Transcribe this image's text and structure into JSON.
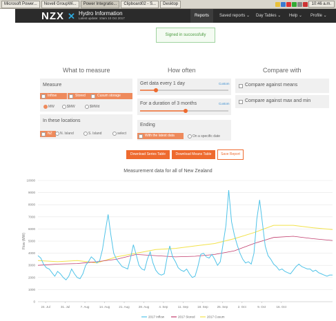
{
  "taskbar": {
    "tasks": [
      "Microsoft Power...",
      "Novell GroupWi...",
      "Power Integratio...",
      "Clipboard02 - S...",
      "Desktop"
    ],
    "clock": "10:46 a.m."
  },
  "header": {
    "logo": "NZX",
    "title": "Hydro Information",
    "subtitle": "Latest update: 10am 10 Oct 2017",
    "nav": [
      "Reports",
      "Saved reports",
      "Day Tables",
      "Help",
      "Profile"
    ]
  },
  "alert": "Signed in successfully",
  "measure": {
    "heading": "What to measure",
    "panel_label": "Measure",
    "checks": [
      "Inflow",
      "Stored",
      "Cusum storage"
    ],
    "units": [
      "MW",
      "$MW",
      "$MWd"
    ],
    "locations_label": "In these locations",
    "locations": [
      "NZ",
      "N. Island",
      "S. Island",
      "select"
    ]
  },
  "often": {
    "heading": "How often",
    "every": "Get data every 1 day",
    "duration": "For a duration of 3 months",
    "custom": "Custom",
    "ending_label": "Ending",
    "ending_options": [
      "With the latest data",
      "On a specific date"
    ]
  },
  "compare": {
    "heading": "Compare with",
    "options": [
      "Compare against means",
      "Compare against max and min"
    ]
  },
  "buttons": {
    "series": "Download Series Table",
    "means": "Download Means Table",
    "save": "Save Report"
  },
  "colors": {
    "accent": "#ee6a2e",
    "inflow": "#4fc3e8",
    "stored": "#c0396a",
    "cusum": "#f2e24a"
  },
  "chart_data": {
    "type": "line",
    "title": "Measurement data for all of New Zealand",
    "ylabel": "Flow (MW)",
    "ylim": [
      0,
      10000
    ],
    "yticks": [
      0,
      1000,
      2000,
      3000,
      4000,
      5000,
      6000,
      7000,
      8000,
      9000,
      10000
    ],
    "xticks": [
      "24. Jul",
      "31. Jul",
      "7. Aug",
      "14. Aug",
      "21. Aug",
      "28. Aug",
      "4. Sep",
      "11. Sep",
      "18. Sep",
      "25. Sep",
      "2. Oct",
      "9. Oct",
      "16. Oct"
    ],
    "x_start": "2017-07-24",
    "series": [
      {
        "name": "2017 Inflow",
        "color": "#4fc3e8",
        "values": [
          [
            0,
            3800
          ],
          [
            1,
            3600
          ],
          [
            2,
            3100
          ],
          [
            3,
            2800
          ],
          [
            4,
            2700
          ],
          [
            5,
            2400
          ],
          [
            6,
            2100
          ],
          [
            7,
            2500
          ],
          [
            8,
            2300
          ],
          [
            9,
            2000
          ],
          [
            10,
            1800
          ],
          [
            11,
            2100
          ],
          [
            12,
            2700
          ],
          [
            13,
            2300
          ],
          [
            14,
            2000
          ],
          [
            15,
            1900
          ],
          [
            16,
            2300
          ],
          [
            17,
            3000
          ],
          [
            18,
            3300
          ],
          [
            19,
            3700
          ],
          [
            20,
            3500
          ],
          [
            21,
            3200
          ],
          [
            22,
            3400
          ],
          [
            23,
            4300
          ],
          [
            24,
            5800
          ],
          [
            25,
            7200
          ],
          [
            26,
            5500
          ],
          [
            27,
            4000
          ],
          [
            28,
            3500
          ],
          [
            29,
            3200
          ],
          [
            30,
            2900
          ],
          [
            31,
            2800
          ],
          [
            32,
            2700
          ],
          [
            33,
            3600
          ],
          [
            34,
            4700
          ],
          [
            35,
            3900
          ],
          [
            36,
            3000
          ],
          [
            37,
            2700
          ],
          [
            38,
            2600
          ],
          [
            39,
            3500
          ],
          [
            40,
            4100
          ],
          [
            41,
            3200
          ],
          [
            42,
            2600
          ],
          [
            43,
            2300
          ],
          [
            44,
            2200
          ],
          [
            45,
            2300
          ],
          [
            46,
            3600
          ],
          [
            47,
            4600
          ],
          [
            48,
            3700
          ],
          [
            49,
            3300
          ],
          [
            50,
            2800
          ],
          [
            51,
            2600
          ],
          [
            52,
            2500
          ],
          [
            53,
            2700
          ],
          [
            54,
            2300
          ],
          [
            55,
            2000
          ],
          [
            56,
            2100
          ],
          [
            57,
            2900
          ],
          [
            58,
            3900
          ],
          [
            59,
            4000
          ],
          [
            60,
            3700
          ],
          [
            61,
            3600
          ],
          [
            62,
            3900
          ],
          [
            63,
            3500
          ],
          [
            64,
            3000
          ],
          [
            65,
            3300
          ],
          [
            66,
            4800
          ],
          [
            67,
            6300
          ],
          [
            68,
            9200
          ],
          [
            69,
            6600
          ],
          [
            70,
            5500
          ],
          [
            71,
            4700
          ],
          [
            72,
            4000
          ],
          [
            73,
            3500
          ],
          [
            74,
            3200
          ],
          [
            75,
            3300
          ],
          [
            76,
            3100
          ],
          [
            77,
            4000
          ],
          [
            78,
            6800
          ],
          [
            79,
            8400
          ],
          [
            80,
            6500
          ],
          [
            81,
            4600
          ],
          [
            82,
            3800
          ],
          [
            83,
            3500
          ],
          [
            84,
            3100
          ],
          [
            85,
            2900
          ],
          [
            86,
            2600
          ],
          [
            87,
            2700
          ],
          [
            88,
            2500
          ],
          [
            89,
            2400
          ],
          [
            90,
            2300
          ],
          [
            91,
            2600
          ],
          [
            92,
            2900
          ],
          [
            93,
            3100
          ],
          [
            94,
            2900
          ],
          [
            95,
            2800
          ],
          [
            96,
            2700
          ],
          [
            97,
            2700
          ],
          [
            98,
            2500
          ],
          [
            99,
            2600
          ],
          [
            100,
            2400
          ],
          [
            101,
            2300
          ],
          [
            102,
            2200
          ],
          [
            103,
            2100
          ],
          [
            104,
            2200
          ],
          [
            105,
            2200
          ]
        ]
      },
      {
        "name": "2017 Stored",
        "color": "#c0396a",
        "values": [
          [
            0,
            3000
          ],
          [
            7,
            3100
          ],
          [
            14,
            3150
          ],
          [
            21,
            3300
          ],
          [
            28,
            3500
          ],
          [
            35,
            3900
          ],
          [
            42,
            3800
          ],
          [
            49,
            3700
          ],
          [
            56,
            3750
          ],
          [
            63,
            3900
          ],
          [
            70,
            4200
          ],
          [
            77,
            4800
          ],
          [
            84,
            5300
          ],
          [
            91,
            5400
          ],
          [
            98,
            5200
          ],
          [
            105,
            5050
          ]
        ]
      },
      {
        "name": "2017 Cusum",
        "color": "#f2e24a",
        "values": [
          [
            0,
            3400
          ],
          [
            7,
            3300
          ],
          [
            14,
            3400
          ],
          [
            21,
            3200
          ],
          [
            28,
            3700
          ],
          [
            35,
            4000
          ],
          [
            42,
            4300
          ],
          [
            49,
            4400
          ],
          [
            56,
            4600
          ],
          [
            63,
            4800
          ],
          [
            70,
            5200
          ],
          [
            77,
            5700
          ],
          [
            84,
            6300
          ],
          [
            91,
            6300
          ],
          [
            98,
            6100
          ],
          [
            105,
            5950
          ]
        ]
      }
    ]
  }
}
